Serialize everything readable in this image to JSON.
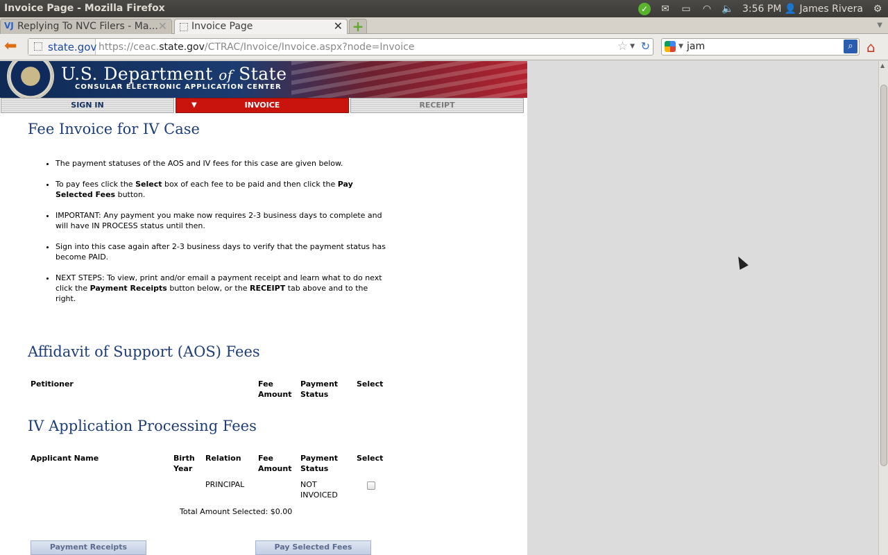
{
  "window": {
    "title": "Invoice Page - Mozilla Firefox"
  },
  "panel": {
    "clock": "3:56 PM",
    "user": "James Rivera"
  },
  "browser": {
    "tabs": [
      {
        "label": "Replying To NVC Filers - Ma...",
        "active": false
      },
      {
        "label": "Invoice Page",
        "active": true
      }
    ],
    "identity": "state.gov",
    "url_prefix": "https://ceac.",
    "url_domain": "state.gov",
    "url_rest": "/CTRAC/Invoice/Invoice.aspx?node=Invoice",
    "search_text": "jam"
  },
  "site": {
    "dept_name_a": "U.S. Department ",
    "dept_name_of": "of",
    "dept_name_b": " State",
    "center_name": "CONSULAR ELECTRONIC APPLICATION CENTER",
    "nav": {
      "sign_in": "SIGN IN",
      "invoice": "INVOICE",
      "receipt": "RECEIPT"
    }
  },
  "invoice": {
    "title": "Fee Invoice for IV Case",
    "notes": {
      "n1": "The payment statuses of the AOS and IV fees for this case are given below.",
      "n2_a": "To pay fees click the ",
      "n2_b": "Select",
      "n2_c": " box of each fee to be paid and then click the ",
      "n2_d": "Pay Selected Fees",
      "n2_e": " button.",
      "n3": "IMPORTANT: Any payment you make now requires 2-3 business days to complete and will have IN PROCESS status until then.",
      "n4": "Sign into this case again after 2-3 business days to verify that the payment status has become PAID.",
      "n5_a": "NEXT STEPS: To view, print and/or email a payment receipt and learn what to do next click the ",
      "n5_b": "Payment Receipts",
      "n5_c": " button below, or the ",
      "n5_d": "RECEIPT",
      "n5_e": " tab above and to the right."
    },
    "aos": {
      "title": "Affidavit of Support (AOS) Fees",
      "headers": {
        "petitioner": "Petitioner",
        "fee_amount": "Fee Amount",
        "payment_status": "Payment Status",
        "select": "Select"
      }
    },
    "iv": {
      "title": "IV Application Processing Fees",
      "headers": {
        "applicant_name": "Applicant Name",
        "birth_year": "Birth Year",
        "relation": "Relation",
        "fee_amount": "Fee Amount",
        "payment_status": "Payment Status",
        "select": "Select"
      },
      "rows": [
        {
          "applicant_name": "",
          "birth_year": "",
          "relation": "PRINCIPAL",
          "fee_amount": "",
          "payment_status": "NOT INVOICED",
          "selected": false
        }
      ]
    },
    "total_label": "Total Amount Selected: $0.00",
    "buttons": {
      "payment_receipts": "Payment Receipts",
      "pay_selected": "Pay Selected Fees"
    }
  },
  "colors": {
    "heading": "#1c3d7a",
    "active_tab": "#c9140d"
  }
}
